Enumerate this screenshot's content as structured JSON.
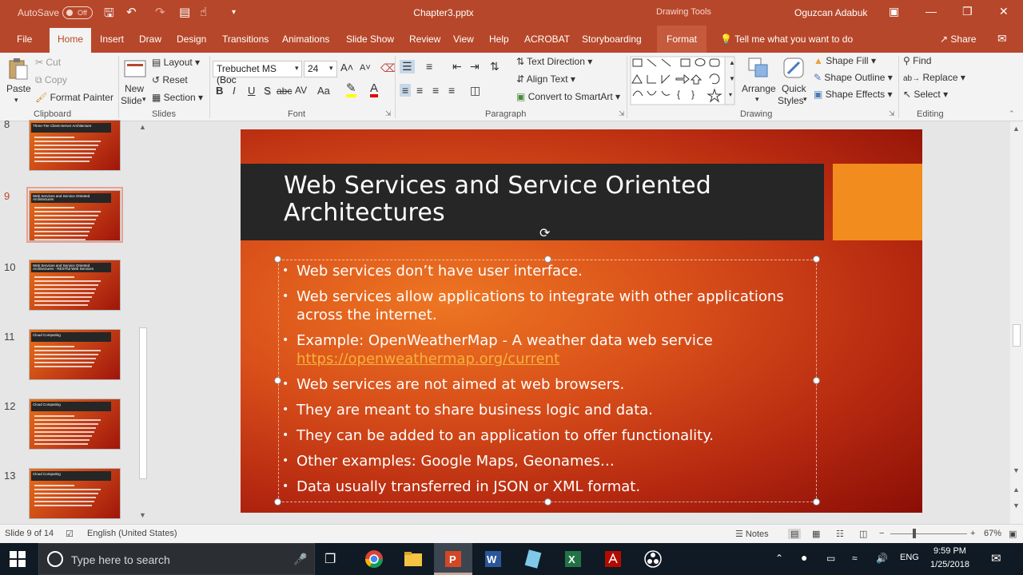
{
  "titlebar": {
    "autosave_label": "AutoSave",
    "autosave_state": "Off",
    "document_title": "Chapter3.pptx",
    "contextual_tools": "Drawing Tools",
    "user_name": "Oguzcan Adabuk"
  },
  "tabs": [
    "File",
    "Home",
    "Insert",
    "Draw",
    "Design",
    "Transitions",
    "Animations",
    "Slide Show",
    "Review",
    "View",
    "Help",
    "ACROBAT",
    "Storyboarding",
    "Format"
  ],
  "active_tab": "Home",
  "tell_me": "Tell me what you want to do",
  "share_label": "Share",
  "ribbon": {
    "clipboard": {
      "label": "Clipboard",
      "paste": "Paste",
      "cut": "Cut",
      "copy": "Copy",
      "format_painter": "Format Painter"
    },
    "slides": {
      "label": "Slides",
      "new_slide_line1": "New",
      "new_slide_line2": "Slide",
      "layout": "Layout",
      "reset": "Reset",
      "section": "Section"
    },
    "font": {
      "label": "Font",
      "font_name": "Trebuchet MS (Boc",
      "font_size": "24",
      "bold": "B",
      "italic": "I",
      "underline": "U",
      "shadow": "S",
      "strike": "abc",
      "spacing": "AV",
      "case": "Aa"
    },
    "paragraph": {
      "label": "Paragraph",
      "text_direction": "Text Direction",
      "align_text": "Align Text",
      "convert_smartart": "Convert to SmartArt"
    },
    "drawing": {
      "label": "Drawing",
      "arrange": "Arrange",
      "quick_styles_line1": "Quick",
      "quick_styles_line2": "Styles",
      "shape_fill": "Shape Fill",
      "shape_outline": "Shape Outline",
      "shape_effects": "Shape Effects"
    },
    "editing": {
      "label": "Editing",
      "find": "Find",
      "replace": "Replace",
      "select": "Select"
    }
  },
  "thumbnails": [
    {
      "number": "8",
      "title": "Three-Tier Client-Server Architecture",
      "lines": 7
    },
    {
      "number": "9",
      "title": "Web Services and Service Oriented Architectures",
      "lines": 9,
      "selected": true
    },
    {
      "number": "10",
      "title": "Web Services and Service Oriented Architectures - RESTful Web Services",
      "lines": 8
    },
    {
      "number": "11",
      "title": "Cloud Computing",
      "lines": 6
    },
    {
      "number": "12",
      "title": "Cloud Computing",
      "lines": 8
    },
    {
      "number": "13",
      "title": "Cloud Computing",
      "lines": 6
    }
  ],
  "slide": {
    "title_line1": "Web Services and Service Oriented",
    "title_line2": "Architectures",
    "bullets": [
      "Web services don’t have user interface.",
      "Web services allow applications to integrate with other applications across the internet.",
      "Example: OpenWeatherMap - A weather data web service",
      "Web services are not aimed at web browsers.",
      "They are meant to share business logic and data.",
      "They can be added to an application to offer functionality.",
      "Other examples: Google Maps, Geonames…",
      "Data usually transferred in JSON or XML format."
    ],
    "link": "https://openweathermap.org/current"
  },
  "status": {
    "slide_indicator": "Slide 9 of 14",
    "language": "English (United States)",
    "notes": "Notes",
    "zoom": "67%"
  },
  "taskbar": {
    "search_placeholder": "Type here to search",
    "language": "ENG",
    "time": "9:59 PM",
    "date": "1/25/2018"
  },
  "colors": {
    "accent": "#b7472a",
    "link": "#f7b23b",
    "slide_orange": "#f28c1e"
  }
}
